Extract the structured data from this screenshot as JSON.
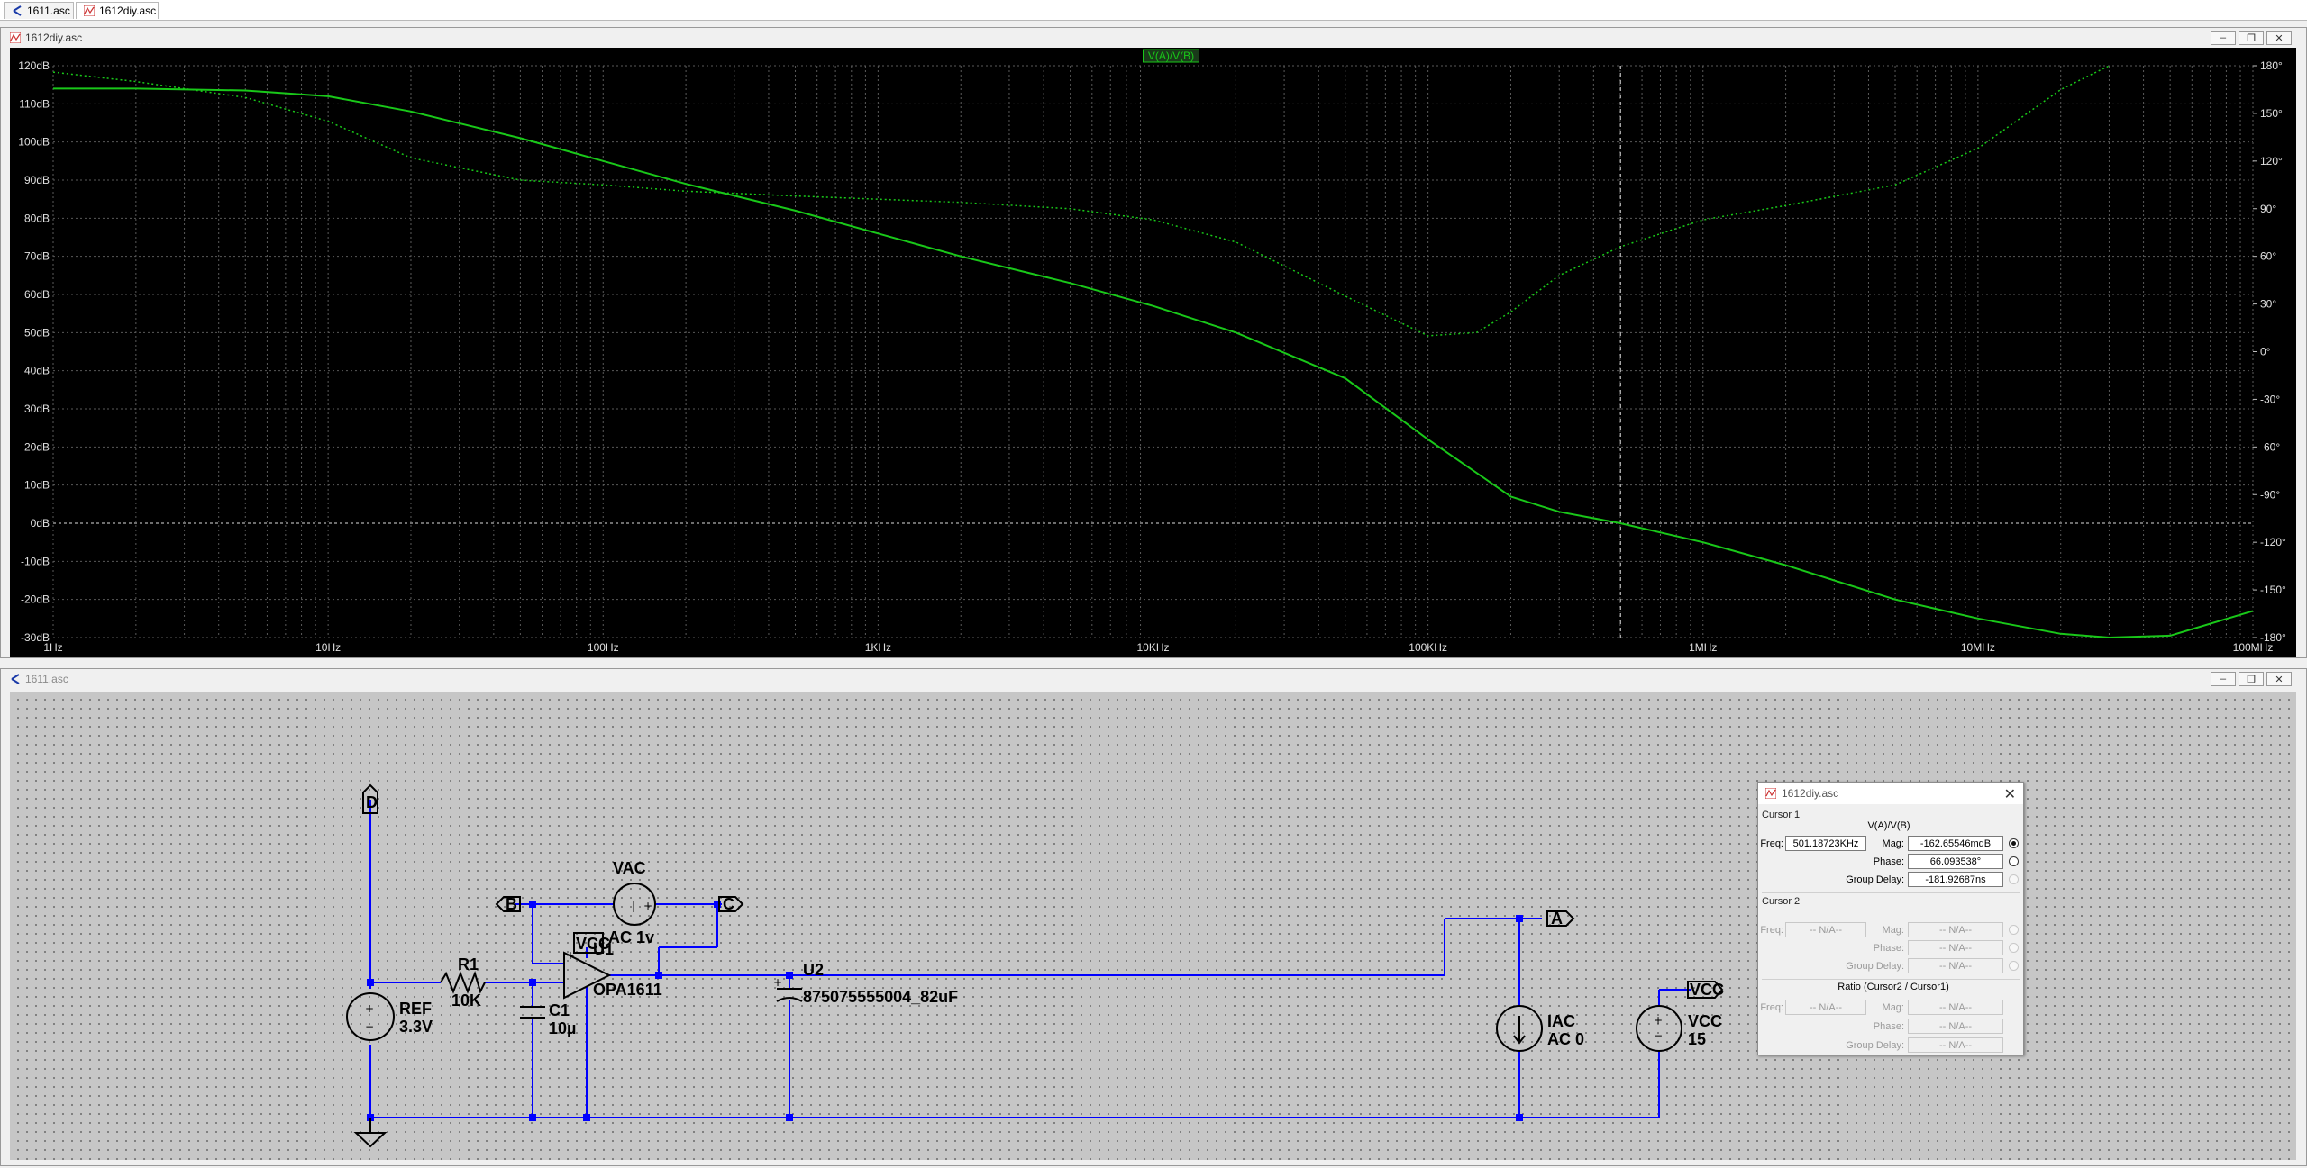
{
  "tabs": [
    {
      "label": "1611.asc",
      "icon": "schematic-icon",
      "active": false
    },
    {
      "label": "1612diy.asc",
      "icon": "waveform-icon",
      "active": true
    }
  ],
  "plot_window": {
    "title": "1612diy.asc",
    "trace_label": "V(A)/V(B)",
    "trace_color": "#19c819",
    "background": "#000000"
  },
  "schematic_window": {
    "title": "1611.asc",
    "wire_color": "#0000ff",
    "labels": {
      "vac_name": "VAC",
      "vac_value": "AC 1v",
      "u1_name": "U1",
      "u1_part": "OPA1611",
      "r1_name": "R1",
      "r1_value": "10K",
      "c1_name": "C1",
      "c1_value": "10µ",
      "ref_name": "REF",
      "ref_value": "3.3V",
      "u2_name": "U2",
      "u2_part": "875075555004_82uF",
      "iac_name": "IAC",
      "iac_value": "AC 0",
      "vcc_src_name": "VCC",
      "vcc_src_value": "15",
      "net_b": "B",
      "net_c": "C",
      "net_d": "D",
      "net_a": "A",
      "net_vcc_opamp": "VCC",
      "net_vcc_src": "VCC"
    }
  },
  "cursor_dialog": {
    "title": "1612diy.asc",
    "cursor1_group": "Cursor 1",
    "expr": "V(A)/V(B)",
    "freq_label": "Freq:",
    "freq_value": "501.18723KHz",
    "mag_label": "Mag:",
    "mag_value": "-162.65546mdB",
    "phase_label": "Phase:",
    "phase_value": "66.093538°",
    "gd_label": "Group Delay:",
    "gd_value": "-181.92687ns",
    "cursor2_group": "Cursor 2",
    "na": "-- N/A--",
    "ratio_group": "Ratio (Cursor2 / Cursor1)"
  },
  "chart_data": {
    "type": "line",
    "title": "V(A)/V(B)",
    "x_scale": "log",
    "xlim_hz": [
      1,
      100000000
    ],
    "x_tick_labels": [
      "1Hz",
      "10Hz",
      "100Hz",
      "1KHz",
      "10KHz",
      "100KHz",
      "1MHz",
      "10MHz",
      "100MHz"
    ],
    "ylim_db": [
      -30,
      120
    ],
    "y_tick_labels": [
      "120dB",
      "110dB",
      "100dB",
      "90dB",
      "80dB",
      "70dB",
      "60dB",
      "50dB",
      "40dB",
      "30dB",
      "20dB",
      "10dB",
      "0dB",
      "-10dB",
      "-20dB",
      "-30dB"
    ],
    "y2lim_deg": [
      -180,
      180
    ],
    "y2_tick_labels": [
      "180°",
      "150°",
      "120°",
      "90°",
      "60°",
      "30°",
      "0°",
      "-30°",
      "-60°",
      "-90°",
      "-120°",
      "-150°",
      "-180°"
    ],
    "grid": true,
    "cursor1_freq_hz": 501187.23,
    "series": [
      {
        "name": "V(A)/V(B)",
        "quantity": "magnitude_db",
        "style": "solid",
        "x": [
          1,
          2,
          5,
          10,
          20,
          50,
          100,
          200,
          500,
          1000,
          2000,
          5000,
          10000,
          20000,
          50000,
          100000,
          200000,
          300000,
          500000,
          1000000,
          2000000,
          5000000,
          10000000,
          20000000,
          30000000,
          50000000,
          100000000
        ],
        "y": [
          114,
          114,
          113.5,
          112,
          108,
          101,
          95,
          89,
          82,
          76,
          70,
          63,
          57,
          50,
          38,
          22,
          7,
          3,
          0,
          -5,
          -11,
          -20,
          -25,
          -29,
          -30,
          -29.5,
          -23
        ]
      },
      {
        "name": "V(A)/V(B)",
        "quantity": "phase_deg",
        "style": "dotted",
        "x": [
          1,
          2,
          5,
          10,
          20,
          50,
          100,
          200,
          500,
          1000,
          2000,
          5000,
          10000,
          20000,
          50000,
          100000,
          150000,
          200000,
          300000,
          500000,
          1000000,
          2000000,
          5000000,
          10000000,
          20000000,
          30000000
        ],
        "y": [
          176,
          170,
          160,
          145,
          122,
          108,
          105,
          101,
          98,
          96,
          94,
          90,
          83,
          69,
          35,
          10,
          12,
          25,
          48,
          66,
          83,
          92,
          105,
          128,
          165,
          180
        ]
      }
    ]
  }
}
